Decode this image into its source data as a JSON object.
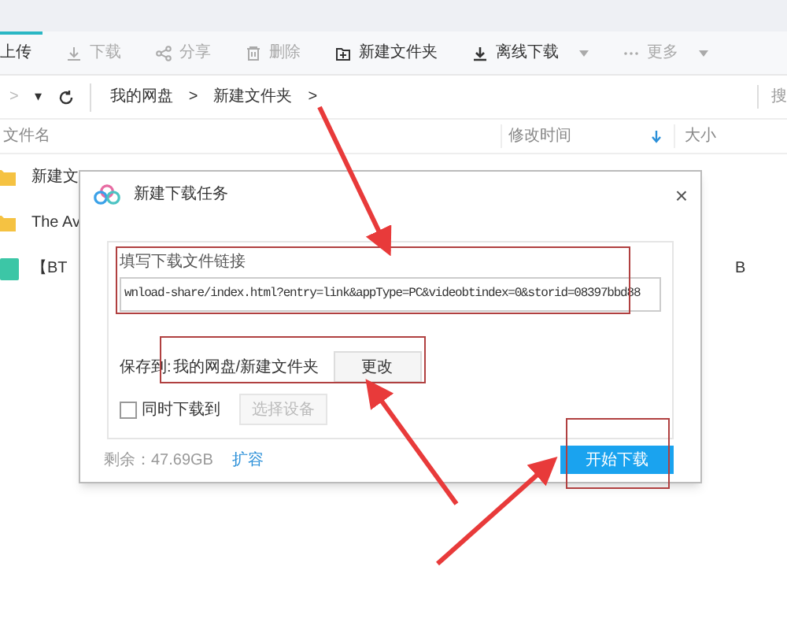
{
  "toolbar": [
    {
      "label": "上传",
      "kind": "upload",
      "disabled": false,
      "caret": false
    },
    {
      "label": "下载",
      "kind": "download",
      "disabled": true,
      "caret": false
    },
    {
      "label": "分享",
      "kind": "share",
      "disabled": true,
      "caret": false
    },
    {
      "label": "删除",
      "kind": "delete",
      "disabled": true,
      "caret": false
    },
    {
      "label": "新建文件夹",
      "kind": "folder",
      "disabled": false,
      "caret": false
    },
    {
      "label": "离线下载",
      "kind": "offline",
      "disabled": false,
      "caret": true
    },
    {
      "label": "更多",
      "kind": "more",
      "disabled": true,
      "caret": true
    }
  ],
  "nav": {
    "forward": ">",
    "dropdown": "▾",
    "breadcrumb": [
      "我的网盘",
      "新建文件夹"
    ],
    "separator": ">",
    "search_cut": "搜"
  },
  "table": {
    "columns": [
      "文件名",
      "修改时间",
      "大小"
    ],
    "rows": [
      {
        "name": "新建文",
        "kind": "folder",
        "size": ""
      },
      {
        "name": "The Av",
        "kind": "folder",
        "size": ""
      },
      {
        "name": "【BT",
        "kind": "bt",
        "size": "B"
      }
    ]
  },
  "dialog": {
    "title": "新建下载任务",
    "close": "×",
    "link_label": "填写下载文件链接",
    "link_value": "wnload-share/index.html?entry=link&appType=PC&videobtindex=0&storid=08397bbd88",
    "save_label": "保存到:",
    "save_path": "我的网盘/新建文件夹",
    "change_button": "更改",
    "also_download": {
      "label": "同时下载到",
      "checked": false
    },
    "device_button": {
      "label": "选择设备",
      "disabled": true
    },
    "free_space": "剩余：47.69GB",
    "expand_link": "扩容",
    "start_button": "开始下载"
  }
}
